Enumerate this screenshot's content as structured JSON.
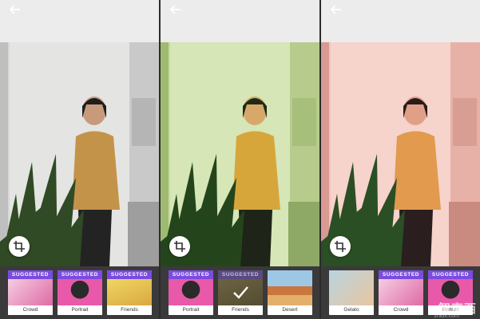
{
  "panels": [
    {
      "photo_tone": "#d7d7d6",
      "thumbs": [
        {
          "badge": "SUGGESTED",
          "label": "Crowd"
        },
        {
          "badge": "SUGGESTED",
          "label": "Portrait"
        },
        {
          "badge": "SUGGESTED",
          "label": "Friends"
        }
      ]
    },
    {
      "photo_tone": "#c9dba4",
      "thumbs": [
        {
          "badge": "SUGGESTED",
          "label": "Portrait"
        },
        {
          "badge": "SUGGESTED",
          "label": "Friends"
        },
        {
          "badge": "",
          "label": "Desert"
        }
      ]
    },
    {
      "photo_tone": "#f2c7be",
      "thumbs": [
        {
          "badge": "",
          "label": "Gelato"
        },
        {
          "badge": "SUGGESTED",
          "label": "Crowd"
        },
        {
          "badge": "SUGGESTED",
          "label": "Portrait"
        }
      ]
    }
  ],
  "watermark": {
    "text": "智東西",
    "sub": "zhidx.com"
  },
  "colors": {
    "accent": "#7b4be0",
    "tray": "#3a3a3a"
  },
  "icons": {
    "back": "back-arrow-icon",
    "crop": "crop-icon"
  }
}
